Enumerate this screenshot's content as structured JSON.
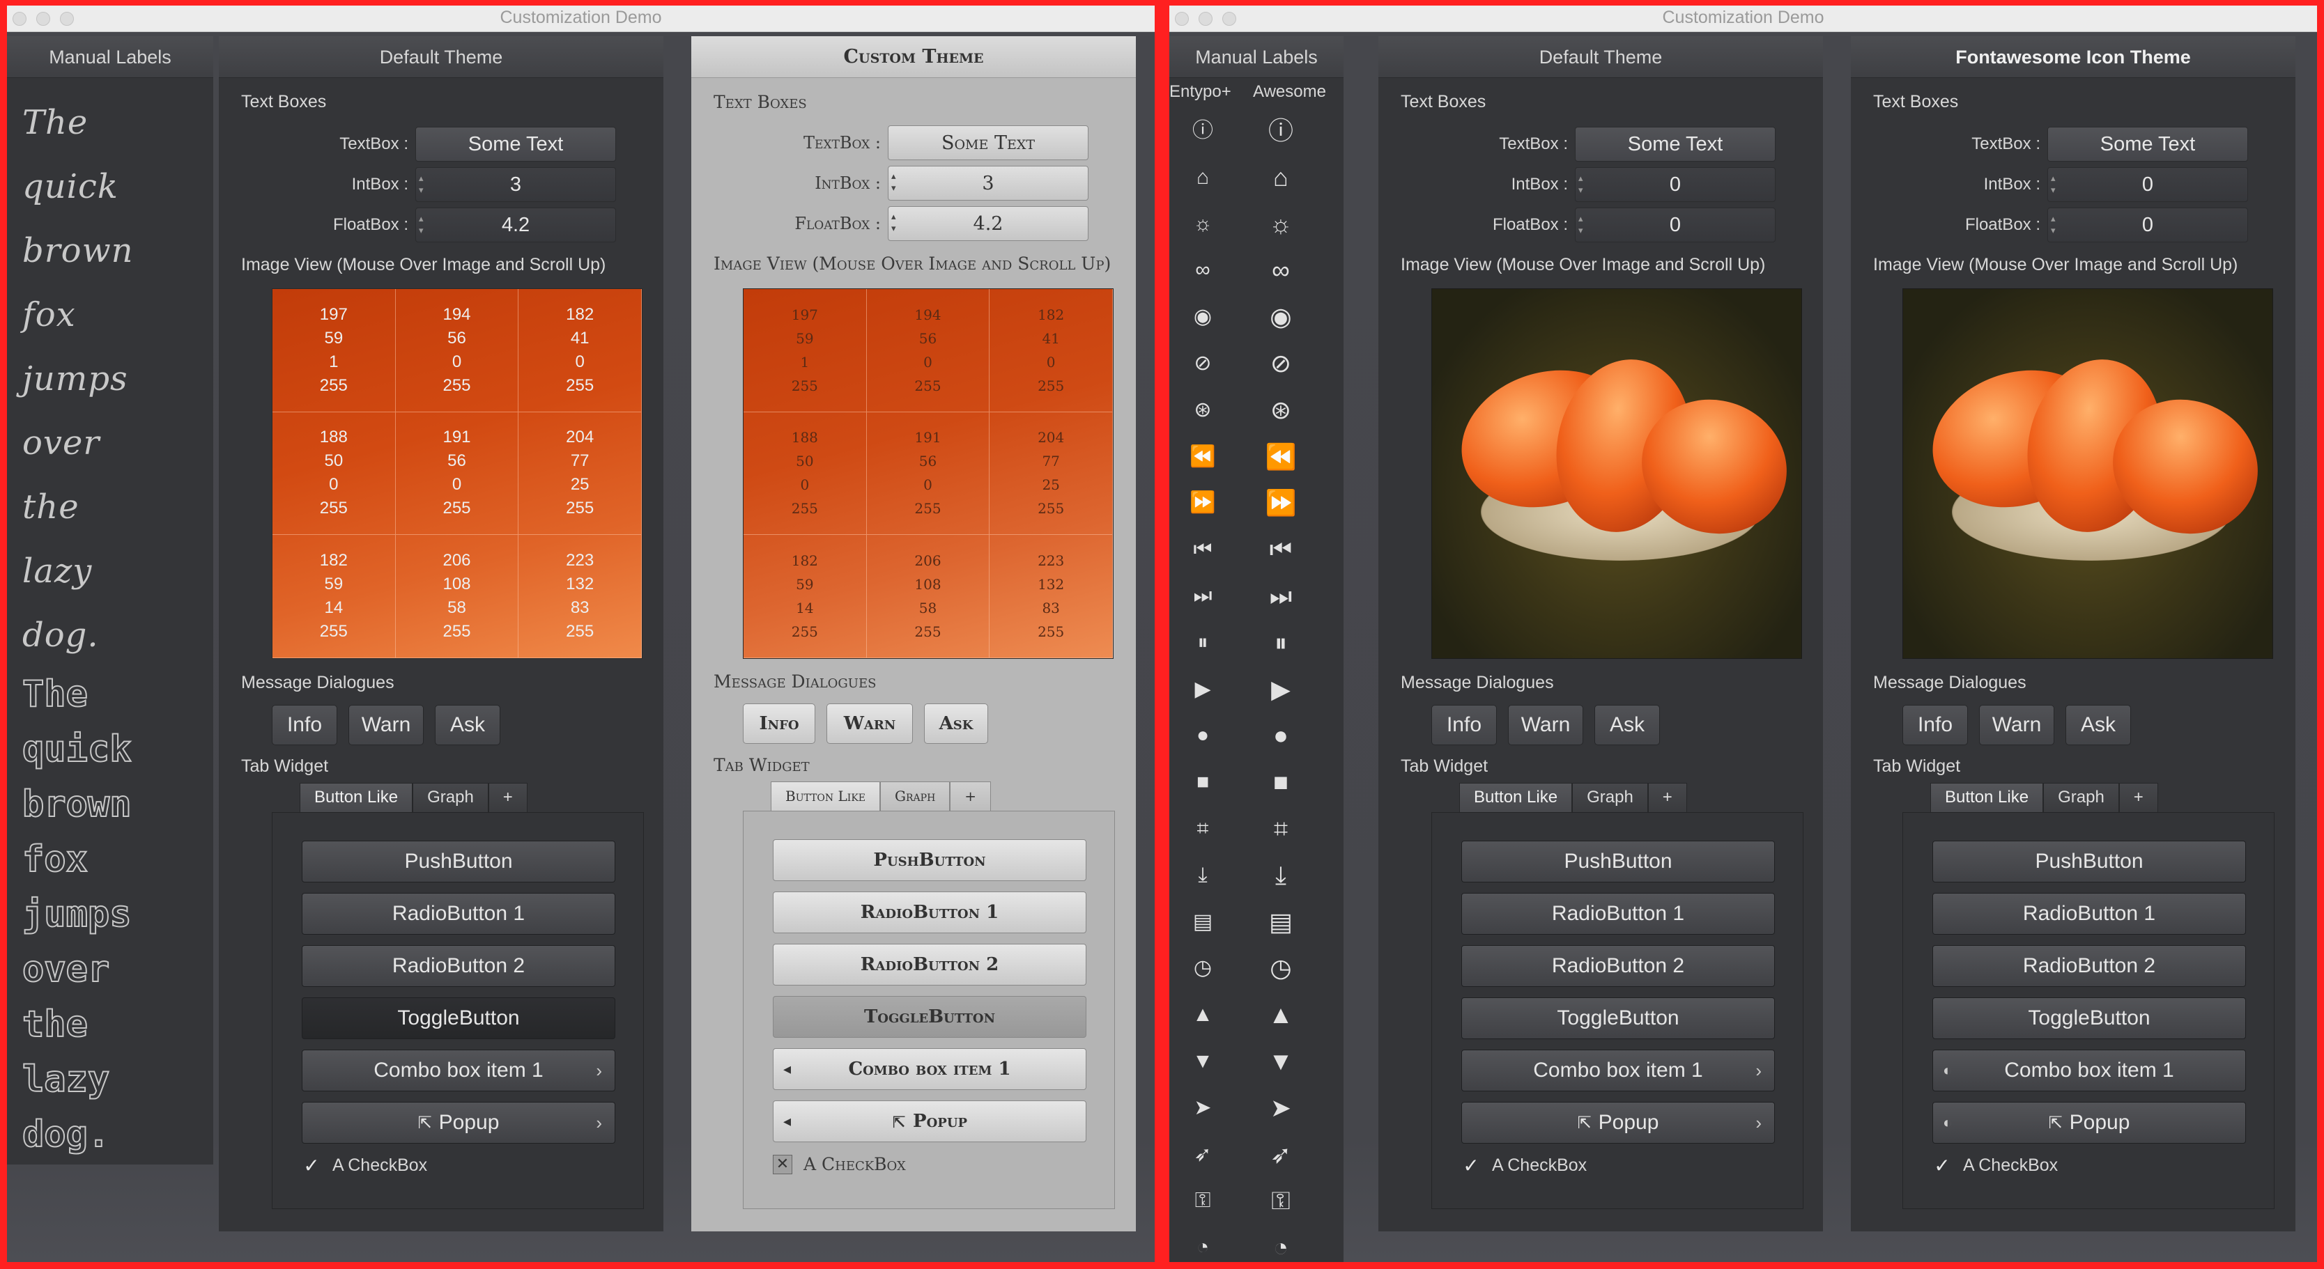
{
  "window": {
    "title": "Customization Demo"
  },
  "manual_labels": {
    "title": "Manual Labels",
    "words": [
      "The",
      "quick",
      "brown",
      "fox",
      "jumps",
      "over",
      "the",
      "lazy",
      "dog."
    ]
  },
  "default_theme": {
    "title": "Default Theme"
  },
  "custom_theme": {
    "title": "Custom Theme"
  },
  "fa_theme": {
    "title": "Fontawesome Icon Theme"
  },
  "sections": {
    "text_boxes": "Text Boxes",
    "image_view": "Image View (Mouse Over Image and Scroll Up)",
    "message_dialogues": "Message Dialogues",
    "tab_widget": "Tab Widget"
  },
  "fields": {
    "textbox_label": "TextBox :",
    "intbox_label": "IntBox :",
    "floatbox_label": "FloatBox :",
    "textbox_value": "Some Text"
  },
  "left_values": {
    "int": "3",
    "float": "4.2"
  },
  "right_values": {
    "int": "0",
    "float": "0"
  },
  "pixel_grid": [
    [
      "197",
      "59",
      "1",
      "255"
    ],
    [
      "194",
      "56",
      "0",
      "255"
    ],
    [
      "182",
      "41",
      "0",
      "255"
    ],
    [
      "188",
      "50",
      "0",
      "255"
    ],
    [
      "191",
      "56",
      "0",
      "255"
    ],
    [
      "204",
      "77",
      "25",
      "255"
    ],
    [
      "182",
      "59",
      "14",
      "255"
    ],
    [
      "206",
      "108",
      "58",
      "255"
    ],
    [
      "223",
      "132",
      "83",
      "255"
    ]
  ],
  "dialogs": {
    "info": "Info",
    "warn": "Warn",
    "ask": "Ask"
  },
  "tabs": {
    "button_like": "Button Like",
    "graph": "Graph",
    "add": "+"
  },
  "widgets": {
    "push": "PushButton",
    "radio1": "RadioButton 1",
    "radio2": "RadioButton 2",
    "toggle": "ToggleButton",
    "combo": "Combo box item 1",
    "popup": "Popup",
    "checkbox": "A CheckBox"
  },
  "icon_columns": {
    "entypo": "Entypo+",
    "awesome": "Awesome"
  },
  "icon_names": [
    "info-circle",
    "home",
    "lightbulb",
    "link",
    "eye",
    "eye-slash",
    "compass",
    "fast-backward",
    "fast-forward",
    "step-backward",
    "step-forward",
    "pause",
    "play",
    "circle",
    "stop",
    "crop",
    "download",
    "clipboard",
    "clock",
    "thumbs-up",
    "thumbs-down",
    "paper-plane",
    "rocket",
    "key",
    "tachometer"
  ],
  "colors": {
    "window_border": "#ff2020",
    "panel_bg": "#343538",
    "custom_panel_bg": "#b7b7b7",
    "image_orange": "#d4541a"
  }
}
